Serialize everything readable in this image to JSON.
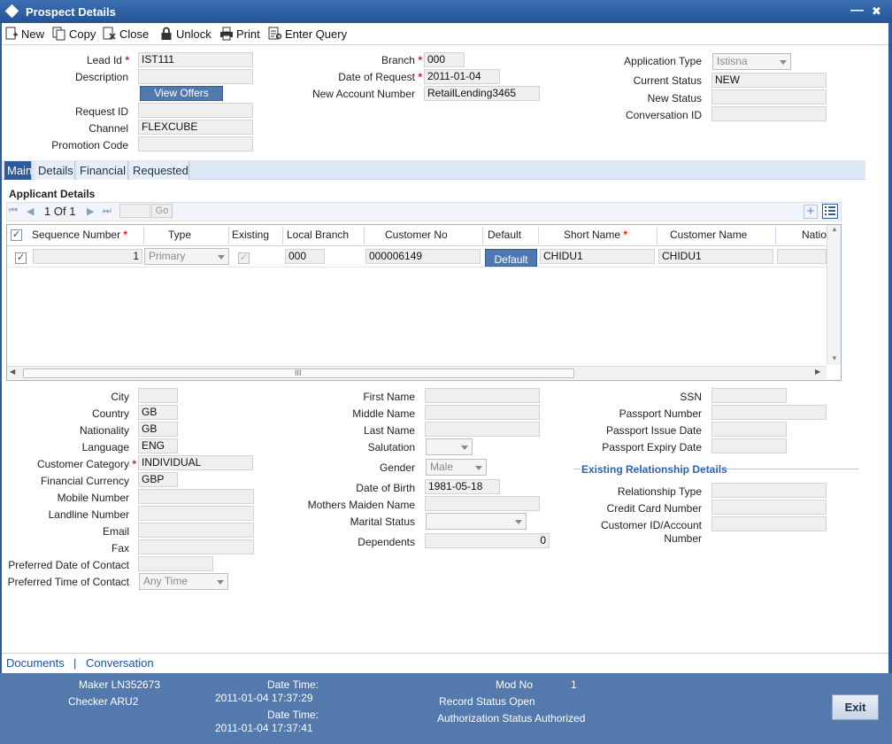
{
  "window": {
    "title": "Prospect Details",
    "minimize": "—",
    "close": "✖"
  },
  "toolbar": {
    "new": "New",
    "copy": "Copy",
    "close": "Close",
    "unlock": "Unlock",
    "print": "Print",
    "enter_query": "Enter Query"
  },
  "header": {
    "lead_id_label": "Lead Id",
    "lead_id": "IST111",
    "description_label": "Description",
    "description": "",
    "view_offers": "View Offers",
    "request_id_label": "Request ID",
    "request_id": "",
    "channel_label": "Channel",
    "channel": "FLEXCUBE",
    "promotion_code_label": "Promotion Code",
    "promotion_code": "",
    "branch_label": "Branch",
    "branch": "000",
    "date_of_request_label": "Date of Request",
    "date_of_request": "2011-01-04",
    "new_account_number_label": "New Account Number",
    "new_account_number": "RetailLending3465",
    "application_type_label": "Application Type",
    "application_type": "Istisna",
    "current_status_label": "Current Status",
    "current_status": "NEW",
    "new_status_label": "New Status",
    "new_status": "",
    "conversation_id_label": "Conversation ID",
    "conversation_id": ""
  },
  "tabs": [
    "Main",
    "Details",
    "Financial",
    "Requested"
  ],
  "applicant": {
    "section_title": "Applicant Details",
    "pager": {
      "page": "1",
      "of_label": "Of",
      "total": "1",
      "go": "Go"
    },
    "columns": [
      "Sequence Number",
      "Type",
      "Existing",
      "Local Branch",
      "Customer No",
      "Default",
      "Short Name",
      "Customer Name",
      "Natio"
    ],
    "row": {
      "sequence": "1",
      "type": "Primary",
      "existing": "✓",
      "local_branch": "000",
      "customer_no": "000006149",
      "default_btn": "Default",
      "short_name": "CHIDU1",
      "customer_name": "CHIDU1",
      "nationality": ""
    },
    "checked": "✓",
    "scroll_mark": "III"
  },
  "details_left": {
    "city_label": "City",
    "city": "",
    "country_label": "Country",
    "country": "GB",
    "nationality_label": "Nationality",
    "nationality": "GB",
    "language_label": "Language",
    "language": "ENG",
    "customer_category_label": "Customer Category",
    "customer_category": "INDIVIDUAL",
    "financial_currency_label": "Financial Currency",
    "financial_currency": "GBP",
    "mobile_label": "Mobile Number",
    "mobile": "",
    "landline_label": "Landline Number",
    "landline": "",
    "email_label": "Email",
    "email": "",
    "fax_label": "Fax",
    "fax": "",
    "pref_date_label": "Preferred Date of Contact",
    "pref_date": "",
    "pref_time_label": "Preferred Time of Contact",
    "pref_time": "Any Time"
  },
  "details_mid": {
    "first_name_label": "First Name",
    "first_name": "",
    "middle_name_label": "Middle Name",
    "middle_name": "",
    "last_name_label": "Last Name",
    "last_name": "",
    "salutation_label": "Salutation",
    "salutation": "",
    "gender_label": "Gender",
    "gender": "Male",
    "dob_label": "Date of Birth",
    "dob": "1981-05-18",
    "maiden_label": "Mothers Maiden Name",
    "maiden": "",
    "marital_label": "Marital Status",
    "marital": "",
    "dependents_label": "Dependents",
    "dependents": "0"
  },
  "details_right": {
    "ssn_label": "SSN",
    "ssn": "",
    "passport_label": "Passport Number",
    "passport": "",
    "passport_issue_label": "Passport Issue Date",
    "passport_issue": "",
    "passport_expiry_label": "Passport Expiry Date",
    "passport_expiry": "",
    "existing_rel_title": "Existing Relationship Details",
    "relationship_type_label": "Relationship Type",
    "relationship_type": "",
    "credit_card_label": "Credit Card Number",
    "credit_card": "",
    "customer_id_label_1": "Customer ID/Account",
    "customer_id_label_2": "Number",
    "customer_id": ""
  },
  "links": {
    "documents": "Documents",
    "separator": "|",
    "conversation": "Conversation"
  },
  "status": {
    "maker": "Maker LN352673",
    "checker": "Checker ARU2",
    "date_time_label": "Date Time:",
    "maker_time": "2011-01-04 17:37:29",
    "checker_time": "2011-01-04 17:37:41",
    "mod_no_label": "Mod No",
    "mod_no": "1",
    "record_status": "Record Status Open",
    "auth_status": "Authorization Status Authorized",
    "exit": "Exit"
  },
  "colors": {
    "title_bar": "#2d5c9d",
    "status_bar": "#5479ad",
    "tab_active": "#2f5b9a",
    "required": "#d62020"
  }
}
